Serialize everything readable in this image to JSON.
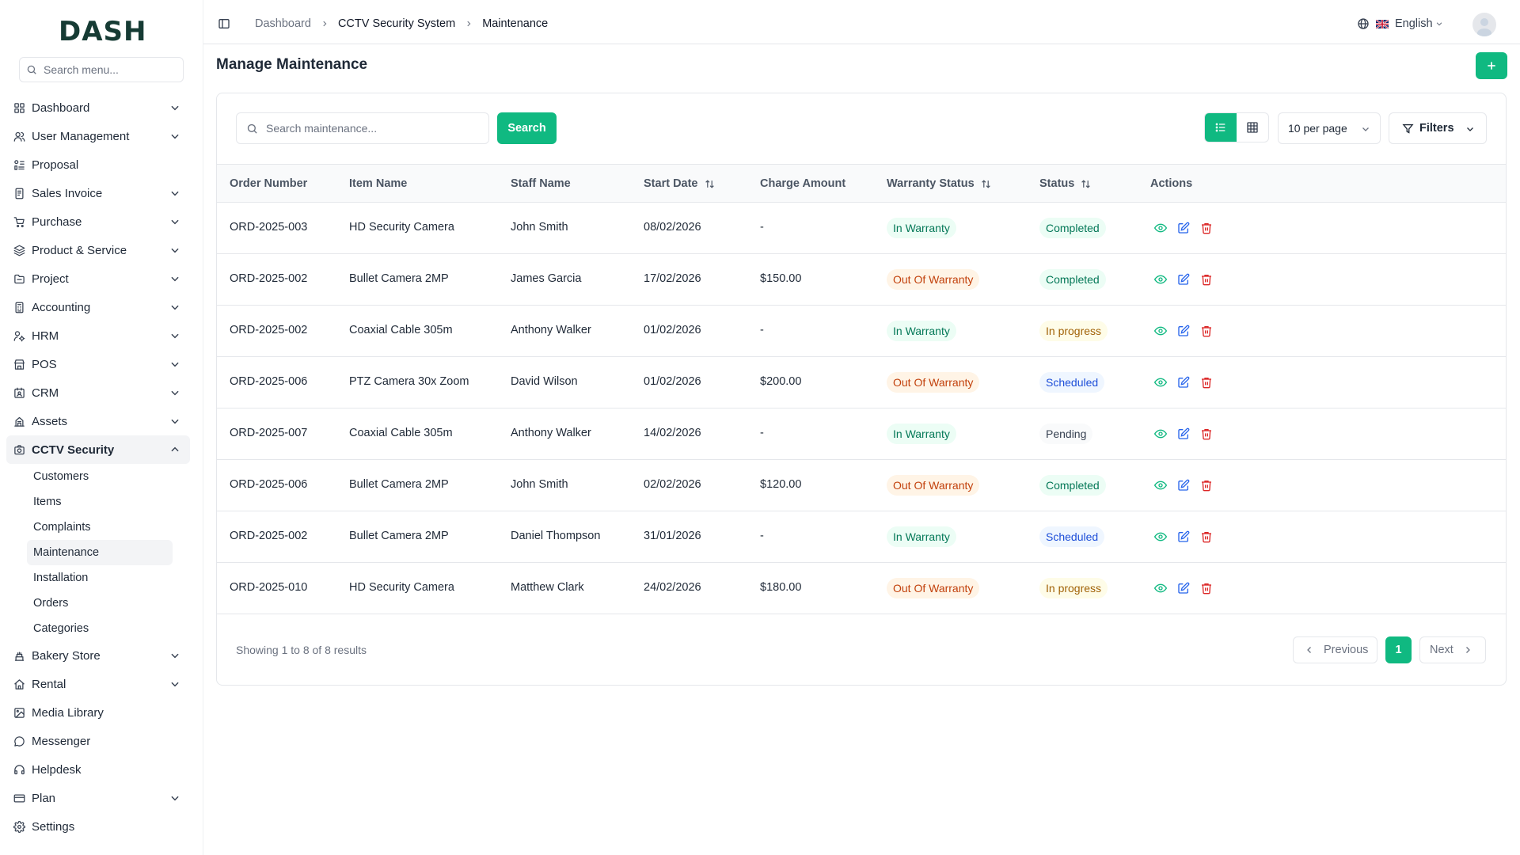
{
  "brand": {
    "logo": "DASH"
  },
  "sidebar": {
    "search_placeholder": "Search menu...",
    "items": [
      {
        "label": "Dashboard",
        "icon": "grid-icon",
        "chevron": true
      },
      {
        "label": "User Management",
        "icon": "users-icon",
        "chevron": true
      },
      {
        "label": "Proposal",
        "icon": "proposal-icon",
        "chevron": false
      },
      {
        "label": "Sales Invoice",
        "icon": "invoice-icon",
        "chevron": true
      },
      {
        "label": "Purchase",
        "icon": "cart-icon",
        "chevron": true
      },
      {
        "label": "Product & Service",
        "icon": "layers-icon",
        "chevron": true
      },
      {
        "label": "Project",
        "icon": "folder-icon",
        "chevron": true
      },
      {
        "label": "Accounting",
        "icon": "calculator-icon",
        "chevron": true
      },
      {
        "label": "HRM",
        "icon": "hrm-icon",
        "chevron": true
      },
      {
        "label": "POS",
        "icon": "store-icon",
        "chevron": true
      },
      {
        "label": "CRM",
        "icon": "crm-icon",
        "chevron": true
      },
      {
        "label": "Assets",
        "icon": "assets-icon",
        "chevron": true
      },
      {
        "label": "CCTV Security",
        "icon": "camera-icon",
        "chevron": true,
        "active": true
      }
    ],
    "cctv_sub": [
      "Customers",
      "Items",
      "Complaints",
      "Maintenance",
      "Installation",
      "Orders",
      "Categories"
    ],
    "items_after": [
      {
        "label": "Bakery Store",
        "icon": "bakery-icon",
        "chevron": true
      },
      {
        "label": "Rental",
        "icon": "home-icon",
        "chevron": true
      },
      {
        "label": "Media Library",
        "icon": "image-icon",
        "chevron": false
      },
      {
        "label": "Messenger",
        "icon": "chat-icon",
        "chevron": false
      },
      {
        "label": "Helpdesk",
        "icon": "headset-icon",
        "chevron": false
      },
      {
        "label": "Plan",
        "icon": "card-icon",
        "chevron": true
      },
      {
        "label": "Settings",
        "icon": "gear-icon",
        "chevron": false
      }
    ]
  },
  "header": {
    "breadcrumb": [
      "Dashboard",
      "CCTV Security System",
      "Maintenance"
    ],
    "language": "English"
  },
  "page": {
    "title": "Manage Maintenance",
    "search_placeholder": "Search maintenance...",
    "search_label": "Search",
    "per_page": "10 per page",
    "filters_label": "Filters"
  },
  "table": {
    "columns": [
      "Order Number",
      "Item Name",
      "Staff Name",
      "Start Date",
      "Charge Amount",
      "Warranty Status",
      "Status",
      "Actions"
    ],
    "rows": [
      {
        "order": "ORD-2025-003",
        "item": "HD Security Camera",
        "staff": "John Smith",
        "date": "08/02/2026",
        "charge": "-",
        "warranty": "In Warranty",
        "status": "Completed"
      },
      {
        "order": "ORD-2025-002",
        "item": "Bullet Camera 2MP",
        "staff": "James Garcia",
        "date": "17/02/2026",
        "charge": "$150.00",
        "warranty": "Out Of Warranty",
        "status": "Completed"
      },
      {
        "order": "ORD-2025-002",
        "item": "Coaxial Cable 305m",
        "staff": "Anthony Walker",
        "date": "01/02/2026",
        "charge": "-",
        "warranty": "In Warranty",
        "status": "In progress"
      },
      {
        "order": "ORD-2025-006",
        "item": "PTZ Camera 30x Zoom",
        "staff": "David Wilson",
        "date": "01/02/2026",
        "charge": "$200.00",
        "warranty": "Out Of Warranty",
        "status": "Scheduled"
      },
      {
        "order": "ORD-2025-007",
        "item": "Coaxial Cable 305m",
        "staff": "Anthony Walker",
        "date": "14/02/2026",
        "charge": "-",
        "warranty": "In Warranty",
        "status": "Pending"
      },
      {
        "order": "ORD-2025-006",
        "item": "Bullet Camera 2MP",
        "staff": "John Smith",
        "date": "02/02/2026",
        "charge": "$120.00",
        "warranty": "Out Of Warranty",
        "status": "Completed"
      },
      {
        "order": "ORD-2025-002",
        "item": "Bullet Camera 2MP",
        "staff": "Daniel Thompson",
        "date": "31/01/2026",
        "charge": "-",
        "warranty": "In Warranty",
        "status": "Scheduled"
      },
      {
        "order": "ORD-2025-010",
        "item": "HD Security Camera",
        "staff": "Matthew Clark",
        "date": "24/02/2026",
        "charge": "$180.00",
        "warranty": "Out Of Warranty",
        "status": "In progress"
      }
    ]
  },
  "pagination": {
    "summary": "Showing 1 to 8 of 8 results",
    "previous": "Previous",
    "current": "1",
    "next": "Next"
  },
  "colors": {
    "accent": "#10b981",
    "edit": "#2563eb",
    "delete": "#dc2626"
  }
}
